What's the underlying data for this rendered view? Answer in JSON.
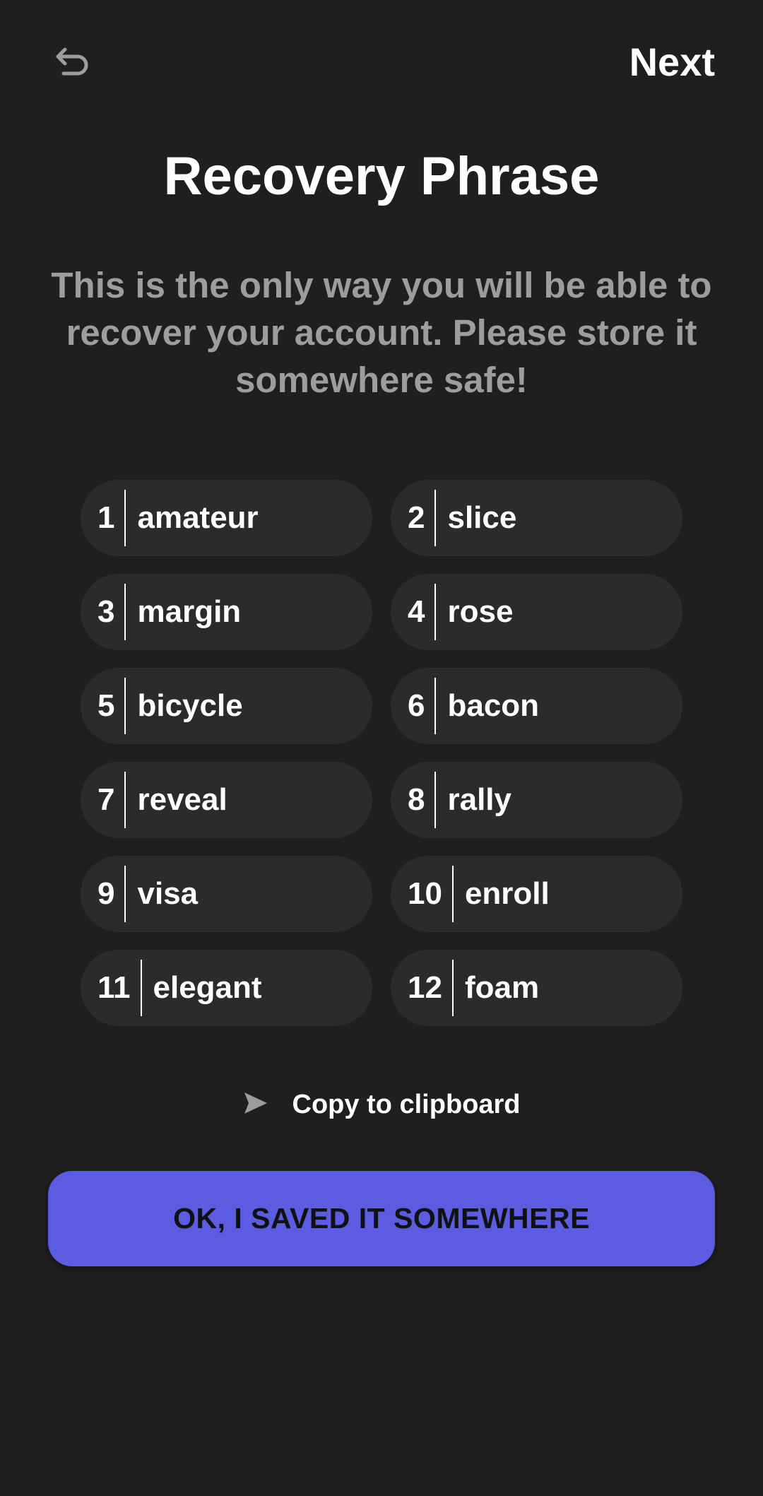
{
  "header": {
    "back_icon": "undo-arrow-icon",
    "next_label": "Next"
  },
  "title": "Recovery Phrase",
  "subtitle": "This is the only way you will be able to recover your account. Please store it somewhere safe!",
  "words": [
    {
      "num": "1",
      "word": "amateur"
    },
    {
      "num": "2",
      "word": "slice"
    },
    {
      "num": "3",
      "word": "margin"
    },
    {
      "num": "4",
      "word": "rose"
    },
    {
      "num": "5",
      "word": "bicycle"
    },
    {
      "num": "6",
      "word": "bacon"
    },
    {
      "num": "7",
      "word": "reveal"
    },
    {
      "num": "8",
      "word": "rally"
    },
    {
      "num": "9",
      "word": "visa"
    },
    {
      "num": "10",
      "word": "enroll"
    },
    {
      "num": "11",
      "word": "elegant"
    },
    {
      "num": "12",
      "word": "foam"
    }
  ],
  "copy": {
    "icon": "send-icon",
    "label": "Copy to clipboard"
  },
  "confirm_button": {
    "label": "OK, I SAVED IT SOMEWHERE"
  },
  "colors": {
    "background": "#1f1f1f",
    "pill": "#2b2b2b",
    "accent": "#5b5ce2",
    "muted_text": "#9d9d9d"
  }
}
